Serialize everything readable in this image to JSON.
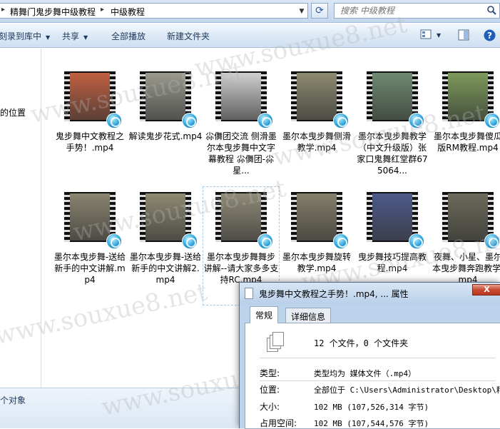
{
  "address_bar": {
    "crumbs": [
      "精舞门鬼步舞中级教程",
      "中级教程"
    ],
    "search_placeholder": "搜索 中级教程"
  },
  "toolbar": {
    "burn_label": "刻录到库中",
    "share_label": "共享",
    "play_all_label": "全部播放",
    "new_folder_label": "新建文件夹"
  },
  "nav": {
    "location_label": "的位置"
  },
  "files": [
    {
      "name": "鬼步舞中文教程之手势！.mp4",
      "frame": "#c06040"
    },
    {
      "name": "解读鬼步花式.mp4",
      "frame": "#9a9a90"
    },
    {
      "name": "尛儛团交流 侧滑墨尔本曳步舞中文字幕教程 尛儛团-尛 星...",
      "frame": "#cfcfcf"
    },
    {
      "name": "墨尔本曳步舞侧滑教学.mp4",
      "frame": "#8c8a70"
    },
    {
      "name": "墨尔本曳步舞教学（中文升级版）张家口鬼舞红堂群675064...",
      "frame": "#6f8a70"
    },
    {
      "name": "墨尔本曳步舞傻瓜版RM教程.mp4",
      "frame": "#7c9a5a"
    },
    {
      "name": "墨尔本曳步舞-送给新手的中文讲解.mp4",
      "frame": "#8a8470"
    },
    {
      "name": "墨尔本曳步舞-送给新手的中文讲解2.mp4",
      "frame": "#8e8a72"
    },
    {
      "name": "墨尔本曳步舞舞步讲解--请大家多多支持RC.mp4",
      "frame": "#908b78"
    },
    {
      "name": "墨尔本曳步舞旋转教学.mp4",
      "frame": "#857f6a"
    },
    {
      "name": "曳步舞技巧提高教程.mp4",
      "frame": "#4d5a8a"
    },
    {
      "name": "夜舞、小星、墨尔本曳步舞奔跑教学.mp4",
      "frame": "#6c6a5a"
    }
  ],
  "status": {
    "count_label": "个对象"
  },
  "dialog": {
    "title": "鬼步舞中文教程之手势！.mp4, ... 属性",
    "close_label": "X",
    "tabs": [
      "常规",
      "详细信息"
    ],
    "summary": "12 个文件，0 个文件夹",
    "props": [
      {
        "label": "类型:",
        "value": "类型均为 媒体文件（.mp4）"
      },
      {
        "label": "位置:",
        "value": "全部位于 C:\\Users\\Administrator\\Desktop\\精"
      },
      {
        "label": "大小:",
        "value": "102 MB (107,526,314 字节)"
      },
      {
        "label": "占用空间:",
        "value": "102 MB (107,544,576 字节)"
      }
    ]
  },
  "watermark": "www.souxue8.net",
  "colors": {
    "toolbar_text": "#1e395b",
    "close_button": "#c74a31"
  }
}
